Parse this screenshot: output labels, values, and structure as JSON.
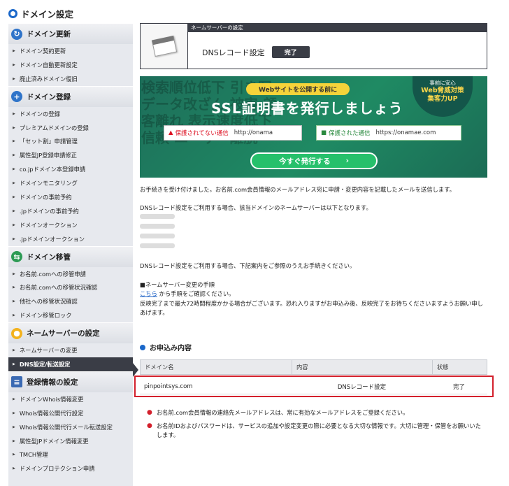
{
  "page_title": "ドメイン設定",
  "sidebar": {
    "sections": [
      {
        "label": "ドメイン更新",
        "icon": "refresh-icon",
        "items": [
          "ドメイン契約更新",
          "ドメイン自動更新設定",
          "廃止済みドメイン復旧"
        ]
      },
      {
        "label": "ドメイン登録",
        "icon": "plus-icon",
        "items": [
          "ドメインの登録",
          "プレミアムドメインの登録",
          "「セット割」申請管理",
          "属性型JP登録申請修正",
          "co.jpドメイン本登録申請",
          "ドメインモニタリング",
          "ドメインの事前予約",
          ".jpドメインの事前予約",
          "ドメインオークション",
          ".jpドメインオークション"
        ]
      },
      {
        "label": "ドメイン移管",
        "icon": "transfer-icon",
        "items": [
          "お名前.comへの移管申請",
          "お名前.comへの移管状況確認",
          "他社への移管状況確認",
          "ドメイン移管ロック"
        ]
      },
      {
        "label": "ネームサーバーの設定",
        "icon": "nameserver-icon",
        "items": [
          "ネームサーバーの変更",
          "DNS設定/転送設定"
        ]
      },
      {
        "label": "登録情報の設定",
        "icon": "book-icon",
        "items": [
          "ドメインWhois情報変更",
          "Whois情報公開代行設定",
          "Whois情報公開代行メール転送設定",
          "属性型JPドメイン情報変更",
          "TMCH管理",
          "ドメインプロテクション申請"
        ]
      }
    ],
    "active_item": "DNS設定/転送設定"
  },
  "complete_box": {
    "header": "ネームサーバーの設定",
    "label": "DNSレコード設定",
    "badge": "完了"
  },
  "banner": {
    "bg_text": "検索順位低下 引き写 データ改ざん 被害 顧客離れ 表示速度低下 信頼 ユーザー離脱",
    "pill": "Webサイトを公開する前に",
    "headline": "SSL証明書を発行しましょう",
    "bad_label": "保護されてない通信",
    "bad_url": "http://onama",
    "good_label": "保護された通信",
    "good_url": "https://onamae.com",
    "button": "今すぐ発行する",
    "badge_line1": "事前に安心",
    "badge_line2": "Web脅威対策",
    "badge_line3": "集客力UP"
  },
  "messages": {
    "accepted": "お手続きを受け付けました。お名前.com会員情報のメールアドレス宛に申請・変更内容を記載したメールを送信します。",
    "ns_intro": "DNSレコード設定をご利用する場合、該当ドメインのネームサーバーは以下となります。",
    "guide_intro": "DNSレコード設定をご利用する場合、下記案内をご参照のうえお手続きください。",
    "procedure_heading": "■ネームサーバー変更の手順",
    "procedure_link": "こちら",
    "procedure_link_suffix": "から手順をご確認ください。",
    "reflection_note": "反映完了まで最大72時間程度かかる場合がございます。恐れ入りますがお申込み後、反映完了をお待ちくださいますようお願い申しあげます。"
  },
  "application": {
    "title": "お申込み内容",
    "columns": [
      "ドメイン名",
      "内容",
      "状態"
    ],
    "rows": [
      {
        "domain": "pinpointsys.com",
        "content": "DNSレコード設定",
        "status": "完了"
      }
    ]
  },
  "notes": [
    "お名前.com会員情報の連絡先メールアドレスは、常に有効なメールアドレスをご登録ください。",
    "お名前IDおよびパスワードは、サービスの追加や設定変更の際に必要となる大切な情報です。大切に管理・保管をお願いいたします。"
  ],
  "colors": {
    "accent": "#1a67c9",
    "dark": "#3a3d46",
    "highlight": "#d3202c",
    "banner_green": "#1f8a63"
  }
}
